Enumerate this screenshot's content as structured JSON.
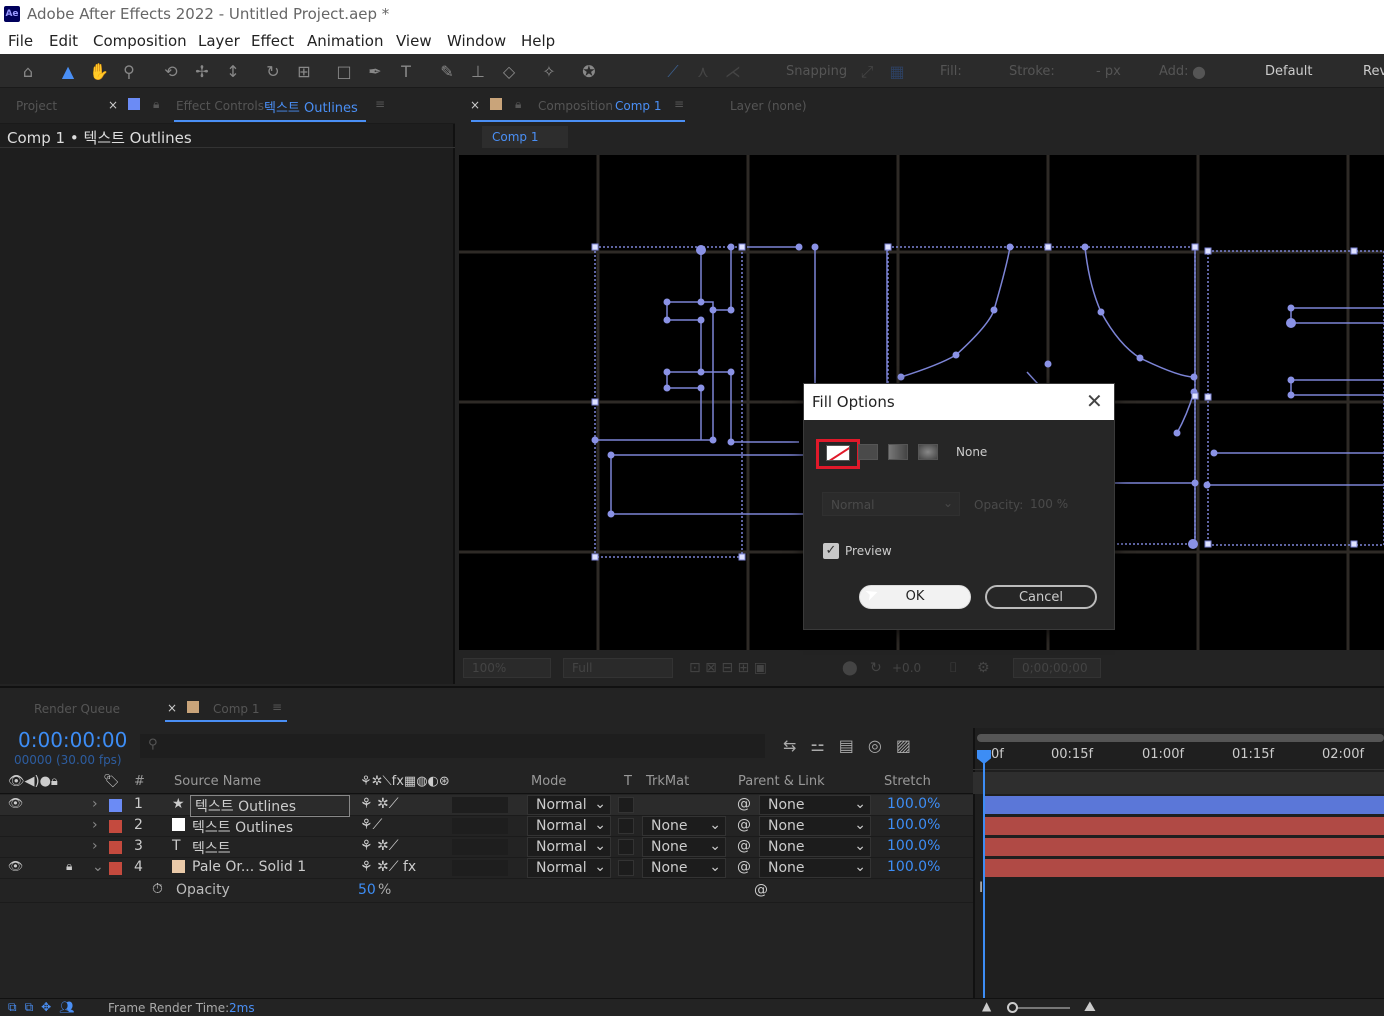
{
  "window": {
    "title": "Adobe After Effects 2022 - Untitled Project.aep *",
    "app_badge": "Ae"
  },
  "menu": [
    "File",
    "Edit",
    "Composition",
    "Layer",
    "Effect",
    "Animation",
    "View",
    "Window",
    "Help"
  ],
  "toolbar": {
    "snapping": "Snapping",
    "fill_label": "Fill:",
    "stroke_label": "Stroke:",
    "stroke_px": "- px",
    "add_label": "Add:",
    "workspace": "Default",
    "workspace2": "Rev"
  },
  "left_panel": {
    "tab_project": "Project",
    "tab_effect_controls": "Effect Controls",
    "effect_layer": "텍스트 Outlines",
    "breadcrumb": "Comp 1 • 텍스트 Outlines"
  },
  "comp_panel": {
    "tab_label": "Composition",
    "comp_name": "Comp 1",
    "layer_tab": "Layer (none)",
    "subtab": "Comp 1"
  },
  "viewer_bar": {
    "zoom": "100%",
    "resolution": "Full",
    "exposure": "+0.0",
    "timecode": "0;00;00;00"
  },
  "dialog": {
    "title": "Fill Options",
    "fill_type": "None",
    "blend_mode": "Normal",
    "opacity_label": "Opacity:",
    "opacity_value": "100 %",
    "preview_label": "Preview",
    "ok": "OK",
    "cancel": "Cancel",
    "preview_checked": true
  },
  "timeline": {
    "tab_render_queue": "Render Queue",
    "tab_comp": "Comp 1",
    "timecode": "0:00:00:00",
    "frames": "00000 (30.00 fps)",
    "columns": {
      "num": "#",
      "source": "Source Name",
      "mode": "Mode",
      "t": "T",
      "trkmat": "TrkMat",
      "parent": "Parent & Link",
      "stretch": "Stretch"
    },
    "ruler": [
      "0f",
      "00:15f",
      "01:00f",
      "01:15f",
      "02:00f"
    ],
    "layers": [
      {
        "num": "1",
        "name": "텍스트 Outlines",
        "mode": "Normal",
        "trkmat": "",
        "parent": "None",
        "stretch": "100.0%",
        "color": "#6b8bf5",
        "bar": "#5b77d8",
        "type": "★"
      },
      {
        "num": "2",
        "name": "텍스트 Outlines",
        "mode": "Normal",
        "trkmat": "None",
        "parent": "None",
        "stretch": "100.0%",
        "color": "#c44a3e",
        "bar": "#b04a45",
        "type": "■"
      },
      {
        "num": "3",
        "name": "텍스트",
        "mode": "Normal",
        "trkmat": "None",
        "parent": "None",
        "stretch": "100.0%",
        "color": "#c44a3e",
        "bar": "#b04a45",
        "type": "T"
      },
      {
        "num": "4",
        "name": "Pale Or... Solid 1",
        "mode": "Normal",
        "trkmat": "None",
        "parent": "None",
        "stretch": "100.0%",
        "color": "#c44a3e",
        "bar": "#b04a45",
        "type": "■"
      }
    ],
    "property": {
      "name": "Opacity",
      "value": "50",
      "unit": "%"
    }
  },
  "status": {
    "label": "Frame Render Time:",
    "value": "2ms"
  }
}
